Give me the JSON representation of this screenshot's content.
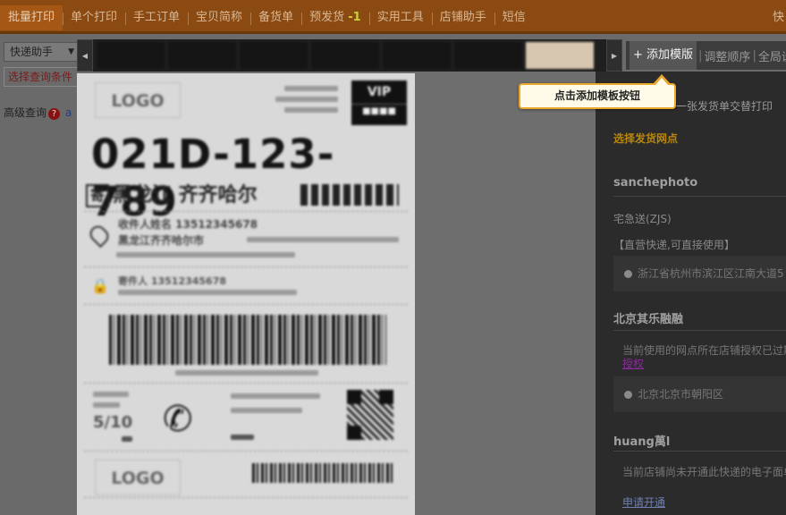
{
  "nav": {
    "tabs": [
      {
        "label": "批量打印",
        "active": true
      },
      {
        "label": "单个打印"
      },
      {
        "label": "手工订单"
      },
      {
        "label": "宝贝简称"
      },
      {
        "label": "备货单"
      },
      {
        "label": "预发货",
        "badge": "-1"
      },
      {
        "label": "实用工具"
      },
      {
        "label": "店铺助手"
      },
      {
        "label": "短信"
      }
    ],
    "right_label": "快"
  },
  "sidebar": {
    "select_value": "快递助手",
    "query_condition": "选择查询条件",
    "advanced_query": "高级查询",
    "help": "?",
    "extra": "a"
  },
  "toolbar": {
    "add_template": "+ 添加模版",
    "adjust_order": "调整顺序",
    "global_settings": "全局设"
  },
  "tooltip": {
    "text": "点击添加模板按钮"
  },
  "label": {
    "logo": "LOGO",
    "vip_top": "VIP",
    "code": "021D-123-789",
    "dest_box": "寄",
    "destination": "黑龙江 齐齐哈尔",
    "rec_name": "收件人姓名  13512345678",
    "rec_addr": "黑龙江齐齐哈尔市",
    "send_name": "寄件人  13512345678",
    "small_num": "5/10"
  },
  "panel": {
    "frag1": "一张发货单交替打印",
    "choose_outlet": "选择发货网点",
    "shops": [
      {
        "name": "sanchephoto",
        "carrier": "宅急送(ZJS)",
        "note": "【直营快递,可直接使用】",
        "address": "浙江省杭州市滨江区江南大道5"
      },
      {
        "name": "北京其乐融融",
        "note": "当前使用的网点所在店铺授权已过期",
        "link": "授权",
        "address": "北京北京市朝阳区"
      },
      {
        "name": "huang萬l",
        "note": "当前店铺尚未开通此快递的电子面单",
        "link": "申请开通"
      }
    ]
  },
  "colors": {
    "nav_bg": "#8a4a12",
    "accent": "#e9a72c",
    "outlet": "#b8860b",
    "link": "#8e2aa0"
  }
}
